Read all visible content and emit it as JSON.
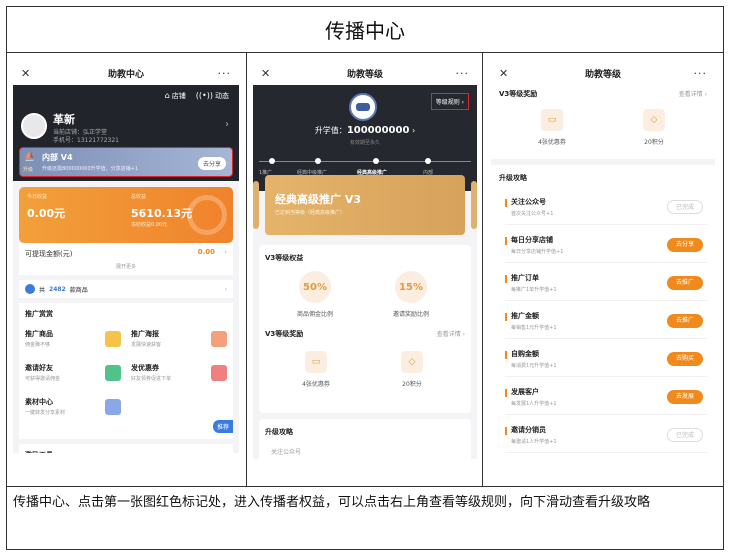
{
  "document": {
    "title": "传播中心",
    "caption": "传播中心、点击第一张图红色标记处，进入传播者权益，可以点击右上角查看等级规则，向下滑动查看升级攻略"
  },
  "screen1": {
    "nav_title": "助教中心",
    "close": "✕",
    "more": "···",
    "tools": [
      {
        "icon": "⌂",
        "label": "店铺"
      },
      {
        "icon": "((•))",
        "label": "动态"
      }
    ],
    "user_name": "革新",
    "store_line": "当前店铺：弘正学堂",
    "phone_line": "手机号：13121772321",
    "tier": {
      "level": "内部 V4",
      "desc": "升级还需800000000升学值，分享店铺+1",
      "button": "去分享",
      "badge": "升级"
    },
    "earnings": {
      "today_label": "今日收益",
      "today_value": "0.00元",
      "total_label": "总收益",
      "total_value": "5610.13元",
      "total_note": "冻结收益0.00元"
    },
    "withdraw": {
      "label": "可提现金额(元)",
      "value": "0.00",
      "expand": "展开更多"
    },
    "goods": {
      "prefix": "共",
      "count": "2482",
      "suffix": "款商品"
    },
    "promo_tools": {
      "heading": "推广赏赏",
      "items": [
        {
          "name": "推广商品",
          "desc": "佣金赚不够",
          "color": "#f5c24a"
        },
        {
          "name": "推广海报",
          "desc": "发展快速获客",
          "color": "#f4a07a"
        },
        {
          "name": "邀请好友",
          "desc": "可获得邀请佣金",
          "color": "#4fc38a"
        },
        {
          "name": "发优惠券",
          "desc": "好友领券促进下单",
          "color": "#f08080"
        },
        {
          "name": "素材中心",
          "desc": "一键转发分享素材",
          "color": "#8aa8e8"
        }
      ],
      "recommend": "推荐"
    },
    "incentive": "激励工具"
  },
  "screen2": {
    "nav_title": "助教等级",
    "close": "✕",
    "more": "···",
    "rules_link": "等级规则 ›",
    "value_label": "升学值：",
    "value": "100000000",
    "validity": "有效期至永久",
    "levels": [
      "1推广",
      "经典中级推广",
      "经典高级推广",
      "内部"
    ],
    "current_level_index": 2,
    "banner_title": "经典高级推广 V3",
    "banner_sub": "已达到当等级（经典高级推广）",
    "rights_heading": "V3等级权益",
    "rights": [
      {
        "value": "50%",
        "label": "商品佣金比例"
      },
      {
        "value": "15%",
        "label": "邀请奖励比例"
      }
    ],
    "rewards_heading": "V3等级奖励",
    "view_detail": "查看详情 ›",
    "rewards": [
      {
        "icon": "▭",
        "label": "4张优惠券"
      },
      {
        "icon": "◇",
        "label": "20积分"
      }
    ],
    "upgrade_heading": "升级攻略",
    "upgrade_peek": "关注公众号"
  },
  "screen3": {
    "nav_title": "助教等级",
    "close": "✕",
    "more": "···",
    "rewards_heading": "V3等级奖励",
    "view_detail": "查看详情 ›",
    "rewards": [
      {
        "icon": "▭",
        "label": "4张优惠券"
      },
      {
        "icon": "◇",
        "label": "20积分"
      }
    ],
    "upgrade_heading": "升级攻略",
    "tasks": [
      {
        "name": "关注公众号",
        "desc": "首次关注公众号+1",
        "button": "已完成",
        "done": true
      },
      {
        "name": "每日分享店铺",
        "desc": "每日分享店铺升学值+1",
        "button": "去分享",
        "done": false
      },
      {
        "name": "推广订单",
        "desc": "每推广1单升学值+1",
        "button": "去推广",
        "done": false
      },
      {
        "name": "推广金额",
        "desc": "每销售1元升学值+1",
        "button": "去推广",
        "done": false
      },
      {
        "name": "自购金额",
        "desc": "每消费1元升学值+1",
        "button": "去购买",
        "done": false
      },
      {
        "name": "发展客户",
        "desc": "每发展1人升学值+1",
        "button": "去发展",
        "done": false
      },
      {
        "name": "邀请分销员",
        "desc": "每邀请1人升学值+1",
        "button": "已完成",
        "done": true
      }
    ]
  }
}
